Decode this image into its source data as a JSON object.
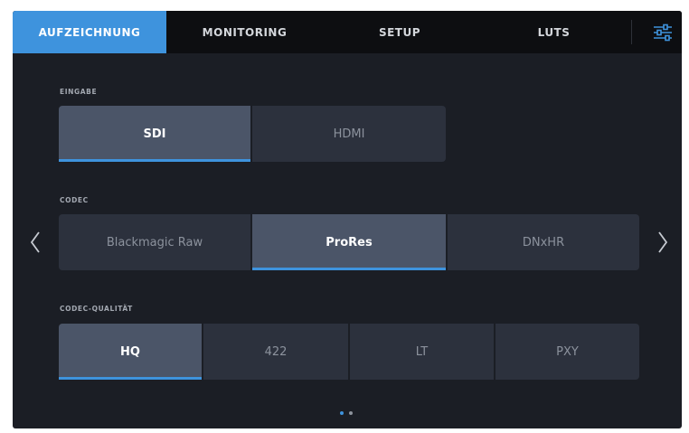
{
  "tabs": [
    {
      "label": "AUFZEICHNUNG",
      "active": true
    },
    {
      "label": "MONITORING",
      "active": false
    },
    {
      "label": "SETUP",
      "active": false
    },
    {
      "label": "LUTS",
      "active": false
    }
  ],
  "settings_icon": "sliders-icon",
  "eingabe": {
    "label": "EINGABE",
    "options": [
      "SDI",
      "HDMI"
    ],
    "selected": "SDI"
  },
  "codec": {
    "label": "CODEC",
    "options": [
      "Blackmagic Raw",
      "ProRes",
      "DNxHR"
    ],
    "selected": "ProRes"
  },
  "quality": {
    "label": "CODEC-QUALITÄT",
    "options": [
      "HQ",
      "422",
      "LT",
      "PXY"
    ],
    "selected": "HQ"
  },
  "pagination": {
    "pages": 2,
    "current": 1
  },
  "colors": {
    "accent": "#3e93dd",
    "background": "#1b1e25",
    "tabbar": "#0d0e11",
    "button": "#2c313d",
    "button_selected": "#4b5568"
  }
}
